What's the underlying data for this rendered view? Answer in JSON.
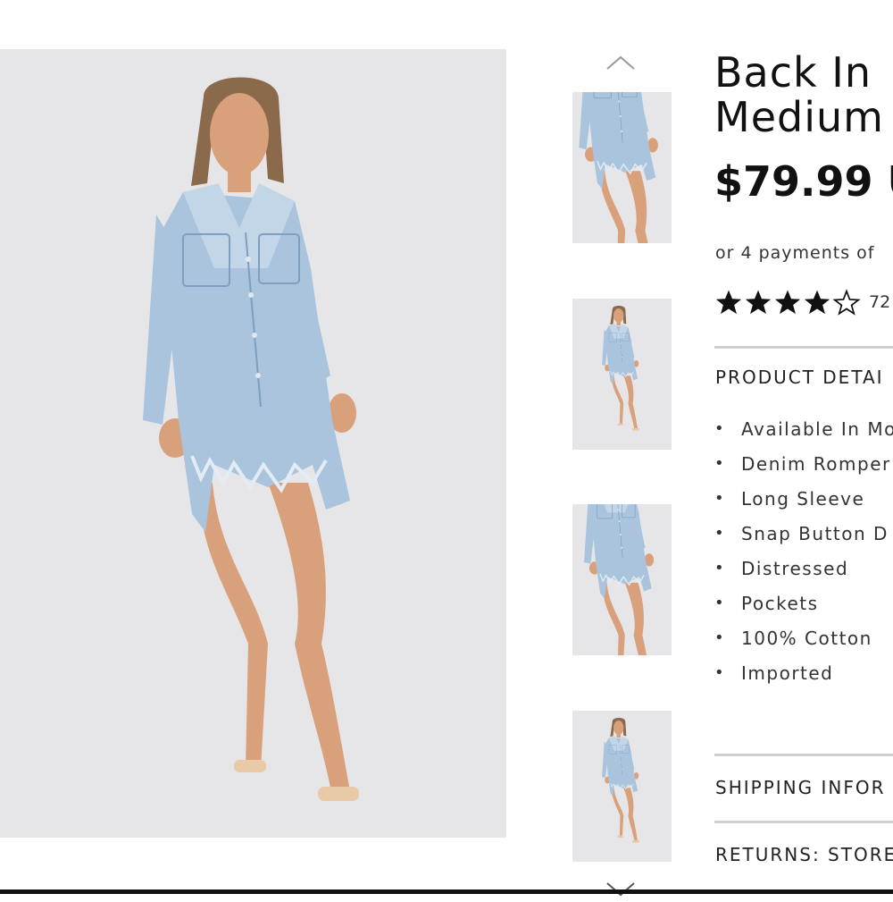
{
  "product": {
    "title_lines": [
      "Back In",
      "Medium"
    ],
    "price": "$79.99 U",
    "payments": "or 4 payments of",
    "rating": {
      "filled_stars": 4,
      "total_stars": 5,
      "count": "72"
    }
  },
  "details": {
    "heading": "PRODUCT DETAI",
    "items": [
      "Available In Mo",
      "Denim Romper",
      "Long Sleeve",
      "Snap Button D",
      "Distressed",
      "Pockets",
      "100% Cotton",
      "Imported"
    ]
  },
  "shipping": {
    "heading": "SHIPPING INFOR"
  },
  "returns": {
    "heading": "RETURNS: STORE"
  },
  "gallery": {
    "thumbnail_count": 4,
    "prev_icon": "chevron-up-icon",
    "next_icon": "chevron-down-icon"
  },
  "colors": {
    "background": "#ffffff",
    "photo_bg": "#e6e6e8",
    "denim": "#a9c4dc",
    "skin": "#d9a07c",
    "rule": "#cfcfcf"
  }
}
